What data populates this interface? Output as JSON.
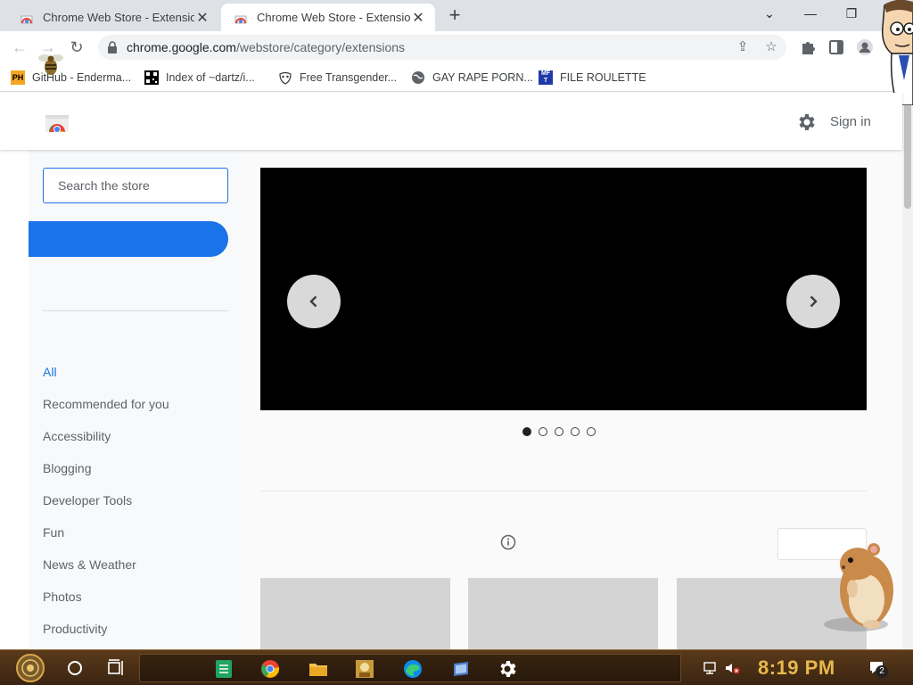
{
  "browser": {
    "tabs": [
      {
        "title": "Chrome Web Store - Extensions",
        "active": false
      },
      {
        "title": "Chrome Web Store - Extensions",
        "active": true
      }
    ],
    "url_host": "chrome.google.com",
    "url_path": "/webstore/category/extensions",
    "bookmarks": [
      {
        "label": "GitHub - Enderma...",
        "icon": "ph-icon"
      },
      {
        "label": "Index of ~dartz/i...",
        "icon": "qr-icon"
      },
      {
        "label": "Free Transgender...",
        "icon": "mask-icon"
      },
      {
        "label": "GAY RAPE PORN...",
        "icon": "globe-icon"
      },
      {
        "label": "FILE ROULETTE",
        "icon": "mft-icon"
      }
    ]
  },
  "store": {
    "signin_label": "Sign in",
    "search_placeholder": "Search the store",
    "categories": [
      "All",
      "Recommended for you",
      "Accessibility",
      "Blogging",
      "Developer Tools",
      "Fun",
      "News & Weather",
      "Photos",
      "Productivity"
    ],
    "active_category": "All",
    "carousel_slide_count": 5,
    "carousel_active_slide": 1
  },
  "taskbar": {
    "clock": "8:19 PM",
    "notification_count": "2"
  },
  "colors": {
    "accent": "#1a73e8",
    "tabstrip": "#dee1e6",
    "clock": "#e8b84a"
  }
}
